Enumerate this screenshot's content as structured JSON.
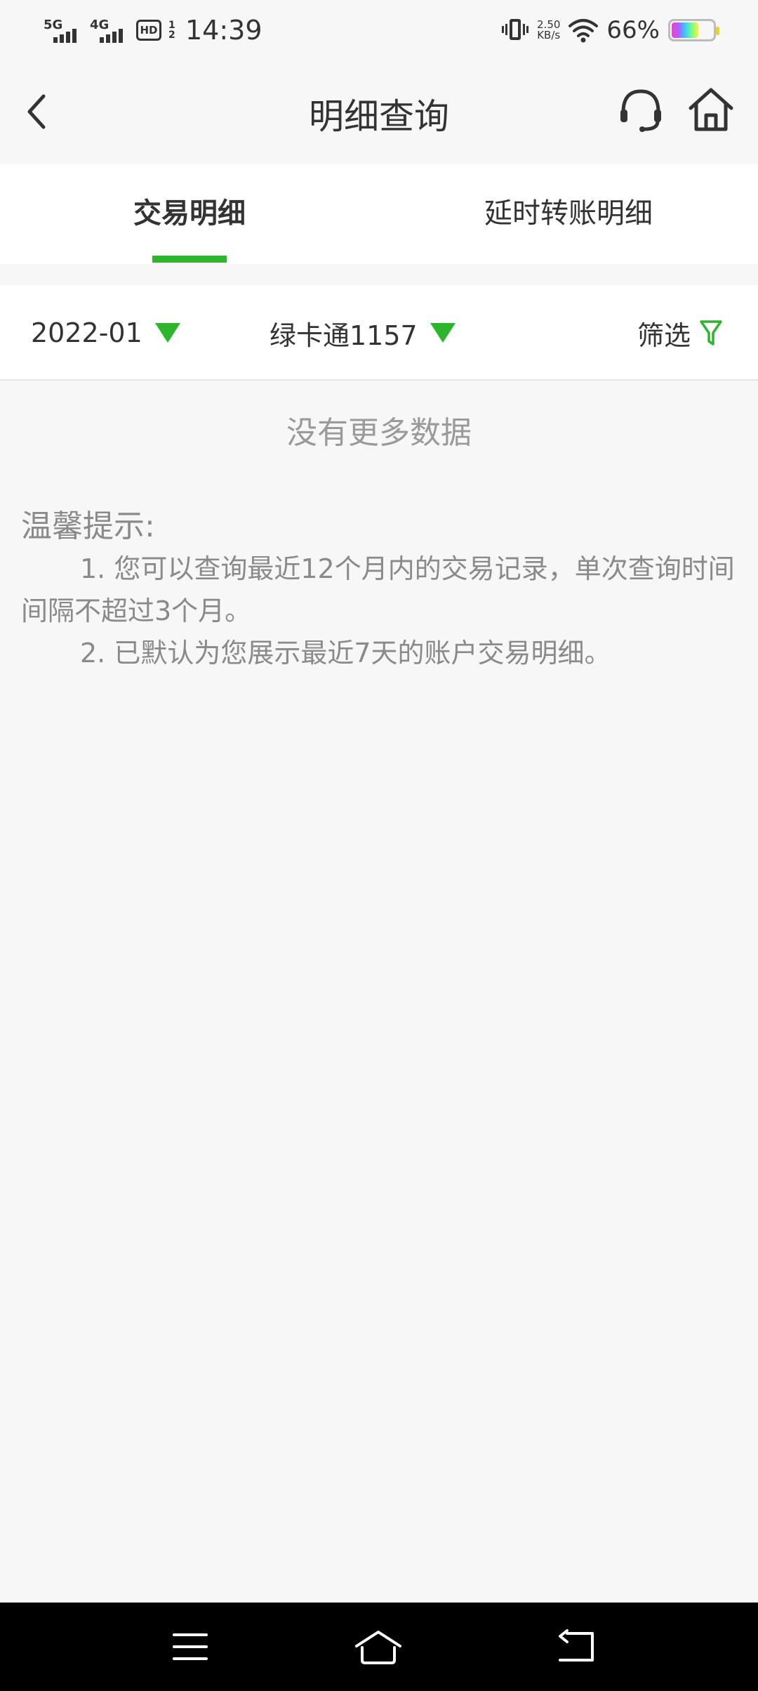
{
  "status_bar": {
    "net1": "5G",
    "net2": "4G",
    "hd": "HD",
    "hd_sub": "1\n2",
    "time": "14:39",
    "speed_value": "2.50",
    "speed_unit": "KB/s",
    "battery_pct": "66%",
    "battery_level": 0.66,
    "icons": [
      "vibrate-icon",
      "wifi-icon",
      "battery-icon"
    ]
  },
  "header": {
    "title": "明细查询",
    "icons": [
      "back-arrow-icon",
      "headset-icon",
      "home-icon"
    ]
  },
  "tabs": [
    {
      "label": "交易明细",
      "active": true
    },
    {
      "label": "延时转账明细",
      "active": false
    }
  ],
  "filters": {
    "date": "2022-01",
    "card": "绿卡通1157",
    "filter_label": "筛选"
  },
  "empty_state": "没有更多数据",
  "tips": {
    "title": "温馨提示:",
    "items": [
      "1. 您可以查询最近12个月内的交易记录，单次查询时间间隔不超过3个月。",
      "2. 已默认为您展示最近7天的账户交易明细。"
    ]
  },
  "nav_bar": {
    "icons": [
      "menu-icon",
      "home-nav-icon",
      "back-nav-icon"
    ]
  },
  "colors": {
    "accent": "#2db52d",
    "background": "#f7f7f7",
    "text": "#333333",
    "muted": "#8a8a8a"
  }
}
